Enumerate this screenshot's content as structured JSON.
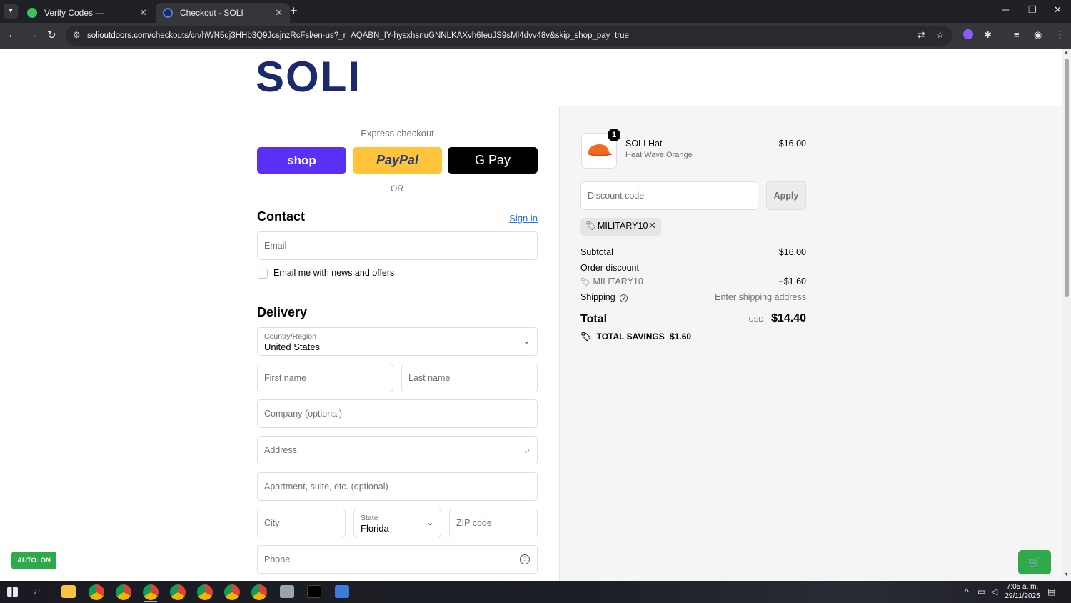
{
  "browser": {
    "tabs": [
      {
        "label": "Verify Codes — SimplyCodes",
        "active": false
      },
      {
        "label": "Checkout - SOLI",
        "active": true
      }
    ],
    "url_domain": "solioutdoors.com",
    "url_path": "/checkouts/cn/hWN5qj3HHb3Q9JcsjnzRcFsl/en-us?_r=AQABN_IY-hysxhsnuGNNLKAXvh6IeuJS9sMl4dvv48v&skip_shop_pay=true"
  },
  "header": {
    "logo": "SOLI"
  },
  "express": {
    "title": "Express checkout",
    "shop_label": "shop",
    "paypal_label": "PayPal",
    "gpay_label": "G Pay",
    "or_label": "OR"
  },
  "contact": {
    "title": "Contact",
    "signin": "Sign in",
    "email_placeholder": "Email",
    "newsletter_label": "Email me with news and offers"
  },
  "delivery": {
    "title": "Delivery",
    "country_label": "Country/Region",
    "country_value": "United States",
    "first_name_placeholder": "First name",
    "last_name_placeholder": "Last name",
    "company_placeholder": "Company (optional)",
    "address_placeholder": "Address",
    "apartment_placeholder": "Apartment, suite, etc. (optional)",
    "city_placeholder": "City",
    "state_label": "State",
    "state_value": "Florida",
    "zip_placeholder": "ZIP code",
    "phone_placeholder": "Phone"
  },
  "summary": {
    "product_name": "SOLI Hat",
    "product_variant": "Heat Wave Orange",
    "product_price": "$16.00",
    "quantity": "1",
    "discount_placeholder": "Discount code",
    "apply_label": "Apply",
    "applied_code": "MILITARY10",
    "subtotal_label": "Subtotal",
    "subtotal_value": "$16.00",
    "order_discount_label": "Order discount",
    "discount_code": "MILITARY10",
    "discount_value": "−$1.60",
    "shipping_label": "Shipping",
    "shipping_value": "Enter shipping address",
    "total_label": "Total",
    "total_currency": "USD",
    "total_value": "$14.40",
    "savings_label": "TOTAL SAVINGS",
    "savings_value": "$1.60"
  },
  "extension": {
    "auto_label": "AUTO: ON"
  },
  "taskbar": {
    "time": "7:05 a. m.",
    "date": "29/11/2025"
  },
  "colors": {
    "brand": "#1c2a6b",
    "shop": "#5a31f4",
    "paypal": "#ffc439",
    "link": "#1a73e8",
    "extension_green": "#2eaa4a"
  }
}
